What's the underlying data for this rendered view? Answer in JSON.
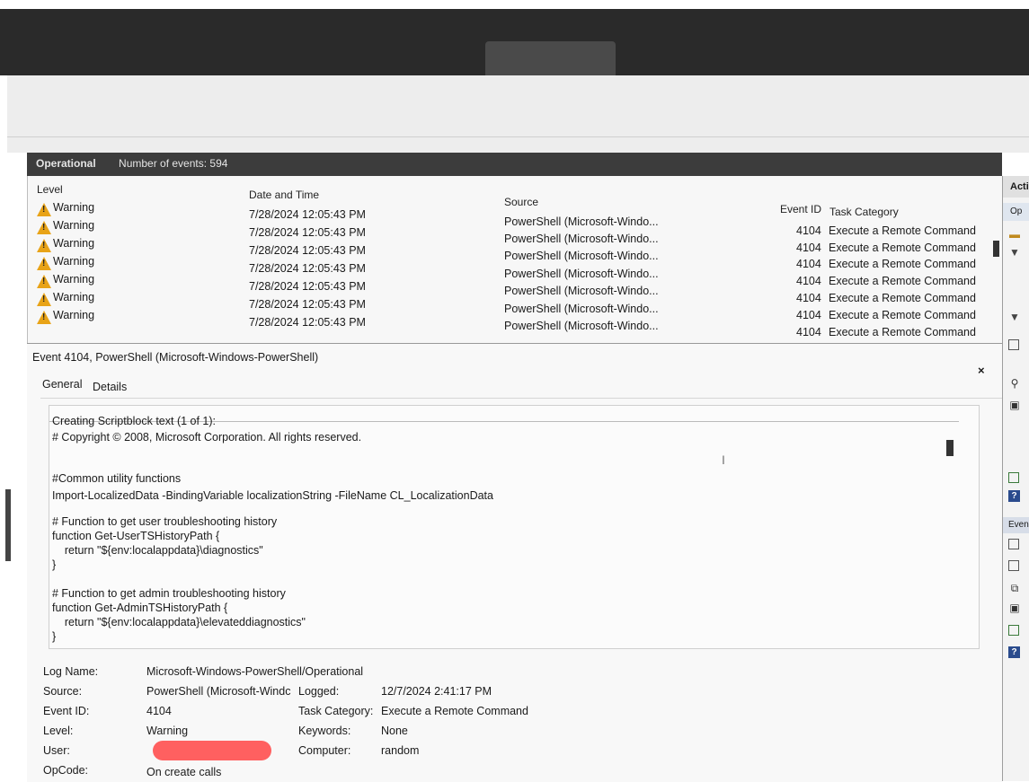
{
  "ops_header": {
    "log_tab": "Operational",
    "count_text": "Number of events: 594"
  },
  "columns": {
    "level": "Level",
    "date": "Date and Time",
    "source": "Source",
    "event_id": "Event ID",
    "task": "Task Category"
  },
  "events": [
    {
      "level": "Warning",
      "date": "7/28/2024 12:05:43 PM",
      "source": "PowerShell (Microsoft-Windo...",
      "event_id": "4104",
      "task": "Execute a Remote Command"
    },
    {
      "level": "Warning",
      "date": "7/28/2024 12:05:43 PM",
      "source": "PowerShell (Microsoft-Windo...",
      "event_id": "4104",
      "task": "Execute a Remote Command"
    },
    {
      "level": "Warning",
      "date": "7/28/2024 12:05:43 PM",
      "source": "PowerShell (Microsoft-Windo...",
      "event_id": "4104",
      "task": "Execute a Remote Command"
    },
    {
      "level": "Warning",
      "date": "7/28/2024 12:05:43 PM",
      "source": "PowerShell (Microsoft-Windo...",
      "event_id": "4104",
      "task": "Execute a Remote Command"
    },
    {
      "level": "Warning",
      "date": "7/28/2024 12:05:43 PM",
      "source": "PowerShell (Microsoft-Windo...",
      "event_id": "4104",
      "task": "Execute a Remote Command"
    },
    {
      "level": "Warning",
      "date": "7/28/2024 12:05:43 PM",
      "source": "PowerShell (Microsoft-Windo...",
      "event_id": "4104",
      "task": "Execute a Remote Command"
    },
    {
      "level": "Warning",
      "date": "7/28/2024 12:05:43 PM",
      "source": "PowerShell (Microsoft-Windo...",
      "event_id": "4104",
      "task": "Execute a Remote Command"
    }
  ],
  "detail": {
    "title": "Event 4104, PowerShell (Microsoft-Windows-PowerShell)",
    "close_glyph": "×",
    "tab_general": "General",
    "tab_details": "Details",
    "script_lines": [
      "Creating Scriptblock text (1 of 1):",
      "# Copyright © 2008, Microsoft Corporation. All rights reserved.",
      "#Common utility functions",
      "Import-LocalizedData -BindingVariable localizationString -FileName CL_LocalizationData",
      "# Function to get user troubleshooting history",
      "function Get-UserTSHistoryPath {",
      "    return \"${env:localappdata}\\diagnostics\"",
      "}",
      "# Function to get admin troubleshooting history",
      "function Get-AdminTSHistoryPath {",
      "    return \"${env:localappdata}\\elevateddiagnostics\"",
      "}"
    ],
    "props": {
      "log_name_label": "Log Name:",
      "log_name": "Microsoft-Windows-PowerShell/Operational",
      "source_label": "Source:",
      "source": "PowerShell (Microsoft-Windc",
      "logged_label": "Logged:",
      "logged": "12/7/2024 2:41:17 PM",
      "event_id_label": "Event ID:",
      "event_id": "4104",
      "task_label": "Task Category:",
      "task": "Execute a Remote Command",
      "level_label": "Level:",
      "level": "Warning",
      "keywords_label": "Keywords:",
      "keywords": "None",
      "user_label": "User:",
      "computer_label": "Computer:",
      "computer": "random",
      "opcode_label": "OpCode:",
      "opcode": "On create calls"
    }
  },
  "actions": {
    "head": "Acti",
    "sub1": "Op",
    "sub2": "Even"
  },
  "icons": {
    "warning": "warning-icon",
    "close": "close-icon",
    "scroll": "scrollbar-thumb"
  },
  "colors": {
    "warning": "#e8a317",
    "header_bg": "#3c3c3c",
    "redaction": "#ff6060"
  }
}
